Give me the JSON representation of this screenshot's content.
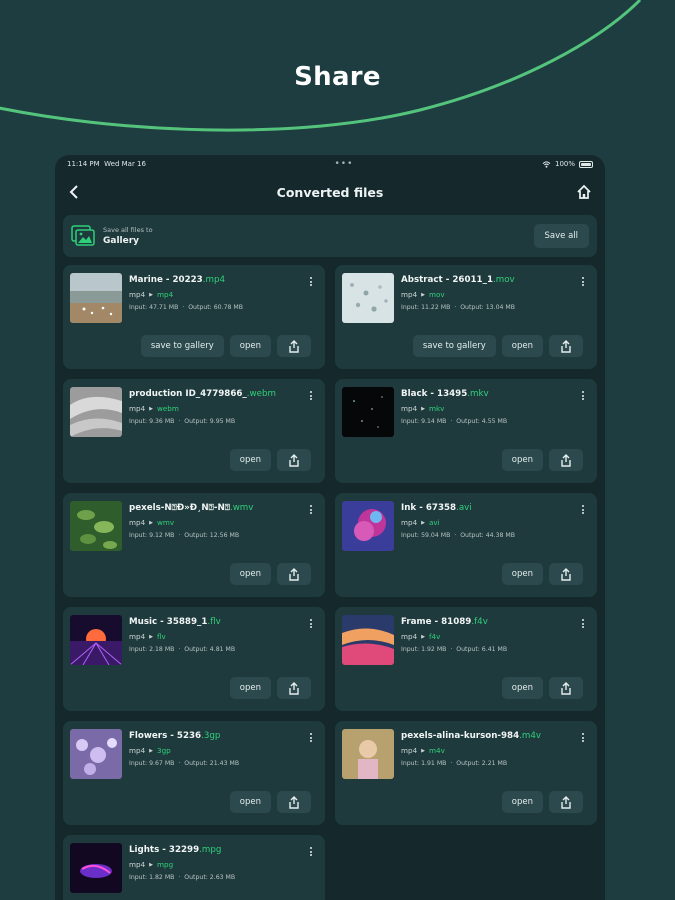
{
  "hero": {
    "title": "Share"
  },
  "status": {
    "time": "11:14 PM",
    "date": "Wed Mar 16",
    "dots": "•••",
    "battery": "100%"
  },
  "nav": {
    "title": "Converted files"
  },
  "gallery": {
    "subtitle": "Save all files to",
    "title": "Gallery",
    "save_all": "Save all"
  },
  "labels": {
    "open": "open",
    "save_to_gallery": "save to gallery"
  },
  "colors": {
    "accent": "#2fd07a",
    "background": "#1e3d40",
    "card": "#1f3a3d",
    "button": "#2c4a4d"
  },
  "files": [
    {
      "name": "Marine - 20223",
      "ext": ".mp4",
      "from": "mp4",
      "to": "mp4",
      "input": "Input: 47.71 MB",
      "output": "Output: 60.78 MB",
      "save": true,
      "thumb": "beach"
    },
    {
      "name": "Abstract - 26011_1",
      "ext": ".mov",
      "from": "mp4",
      "to": "mov",
      "input": "Input: 11.22 MB",
      "output": "Output: 13.04 MB",
      "save": true,
      "thumb": "abstract"
    },
    {
      "name": "production ID_4779866_",
      "ext": ".webm",
      "from": "mp4",
      "to": "webm",
      "input": "Input: 9.36 MB",
      "output": "Output: 9.95 MB",
      "save": false,
      "thumb": "silk"
    },
    {
      "name": "Black - 13495",
      "ext": ".mkv",
      "from": "mp4",
      "to": "mkv",
      "input": "Input: 9.14 MB",
      "output": "Output: 4.55 MB",
      "save": false,
      "thumb": "black"
    },
    {
      "name": "pexels-Ñ⍰Ð»Ð¸Ñ⍰-Ñ⍰",
      "ext": ".wmv",
      "from": "mp4",
      "to": "wmv",
      "input": "Input: 9.12 MB",
      "output": "Output: 12.56 MB",
      "save": false,
      "thumb": "leaves"
    },
    {
      "name": "Ink - 67358",
      "ext": ".avi",
      "from": "mp4",
      "to": "avi",
      "input": "Input: 59.04 MB",
      "output": "Output: 44.38 MB",
      "save": false,
      "thumb": "ink"
    },
    {
      "name": "Music - 35889_1",
      "ext": ".flv",
      "from": "mp4",
      "to": "flv",
      "input": "Input: 2.18 MB",
      "output": "Output: 4.81 MB",
      "save": false,
      "thumb": "music"
    },
    {
      "name": "Frame - 81089",
      "ext": ".f4v",
      "from": "mp4",
      "to": "f4v",
      "input": "Input: 1.92 MB",
      "output": "Output: 6.41 MB",
      "save": false,
      "thumb": "frame"
    },
    {
      "name": "Flowers - 5236",
      "ext": ".3gp",
      "from": "mp4",
      "to": "3gp",
      "input": "Input: 9.67 MB",
      "output": "Output: 21.43 MB",
      "save": false,
      "thumb": "flowers"
    },
    {
      "name": "pexels-alina-kurson-984",
      "ext": ".m4v",
      "from": "mp4",
      "to": "m4v",
      "input": "Input: 1.91 MB",
      "output": "Output: 2.21 MB",
      "save": false,
      "thumb": "portrait"
    },
    {
      "name": "Lights - 32299",
      "ext": ".mpg",
      "from": "mp4",
      "to": "mpg",
      "input": "Input: 1.82 MB",
      "output": "Output: 2.63 MB",
      "save": false,
      "thumb": "lights"
    }
  ]
}
